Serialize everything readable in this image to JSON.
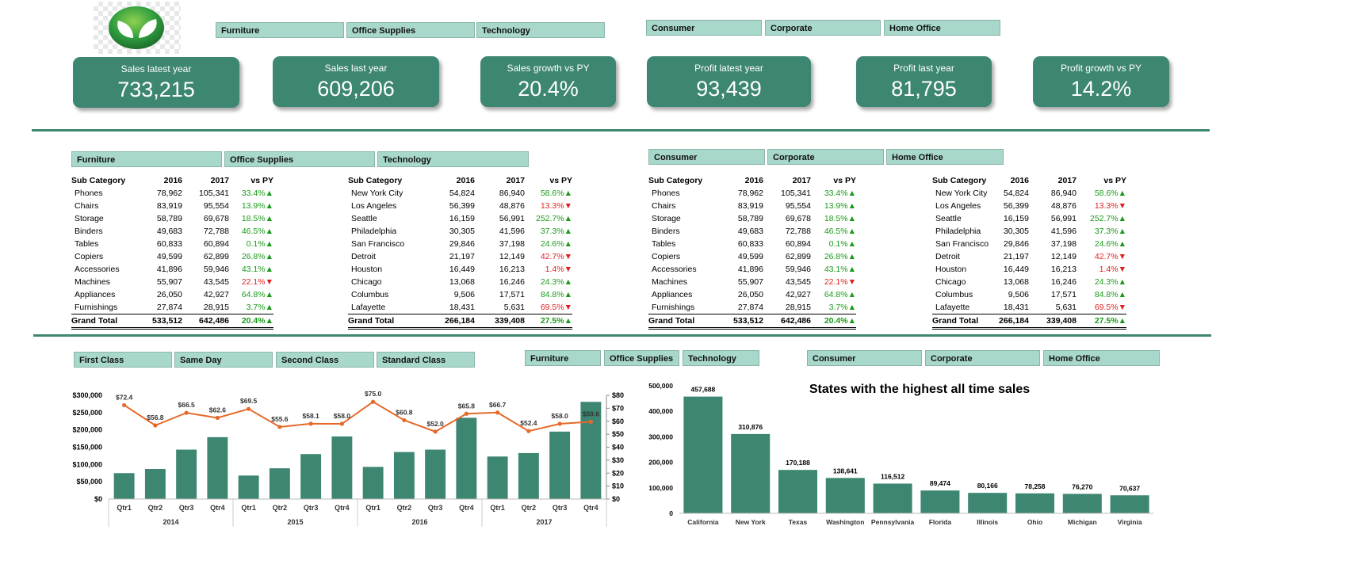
{
  "colors": {
    "accent": "#3d8672",
    "slicer": "#a8d8cb",
    "positive": "#1a9a1a",
    "negative": "#e02020",
    "line": "#e56a2a"
  },
  "logo_icon": "leaf-logo-icon",
  "slicers": {
    "category": [
      "Furniture",
      "Office Supplies",
      "Technology"
    ],
    "segment": [
      "Consumer",
      "Corporate",
      "Home Office"
    ],
    "ship_mode": [
      "First Class",
      "Same Day",
      "Second Class",
      "Standard Class"
    ]
  },
  "kpis": [
    {
      "title": "Sales latest year",
      "value": "733,215"
    },
    {
      "title": "Sales last year",
      "value": "609,206"
    },
    {
      "title": "Sales growth vs PY",
      "value": "20.4%"
    },
    {
      "title": "Profit latest year",
      "value": "93,439"
    },
    {
      "title": "Profit last year",
      "value": "81,795"
    },
    {
      "title": "Profit growth vs PY",
      "value": "14.2%"
    }
  ],
  "sub_table": {
    "headers": [
      "Sub Category",
      "2016",
      "2017",
      "vs PY"
    ],
    "rows": [
      [
        "Phones",
        "78,962",
        "105,341",
        "33.4%▲",
        "up"
      ],
      [
        "Chairs",
        "83,919",
        "95,554",
        "13.9%▲",
        "up"
      ],
      [
        "Storage",
        "58,789",
        "69,678",
        "18.5%▲",
        "up"
      ],
      [
        "Binders",
        "49,683",
        "72,788",
        "46.5%▲",
        "up"
      ],
      [
        "Tables",
        "60,833",
        "60,894",
        "0.1%▲",
        "up"
      ],
      [
        "Copiers",
        "49,599",
        "62,899",
        "26.8%▲",
        "up"
      ],
      [
        "Accessories",
        "41,896",
        "59,946",
        "43.1%▲",
        "up"
      ],
      [
        "Machines",
        "55,907",
        "43,545",
        "22.1%▼",
        "down"
      ],
      [
        "Appliances",
        "26,050",
        "42,927",
        "64.8%▲",
        "up"
      ],
      [
        "Furnishings",
        "27,874",
        "28,915",
        "3.7%▲",
        "up"
      ]
    ],
    "total": [
      "Grand Total",
      "533,512",
      "642,486",
      "20.4%▲"
    ]
  },
  "city_table": {
    "headers": [
      "Sub Category",
      "2016",
      "2017",
      "vs PY"
    ],
    "rows": [
      [
        "New York City",
        "54,824",
        "86,940",
        "58.6%▲",
        "up"
      ],
      [
        "Los Angeles",
        "56,399",
        "48,876",
        "13.3%▼",
        "down"
      ],
      [
        "Seattle",
        "16,159",
        "56,991",
        "252.7%▲",
        "up"
      ],
      [
        "Philadelphia",
        "30,305",
        "41,596",
        "37.3%▲",
        "up"
      ],
      [
        "San Francisco",
        "29,846",
        "37,198",
        "24.6%▲",
        "up"
      ],
      [
        "Detroit",
        "21,197",
        "12,149",
        "42.7%▼",
        "down"
      ],
      [
        "Houston",
        "16,449",
        "16,213",
        "1.4%▼",
        "down"
      ],
      [
        "Chicago",
        "13,068",
        "16,246",
        "24.3%▲",
        "up"
      ],
      [
        "Columbus",
        "9,506",
        "17,571",
        "84.8%▲",
        "up"
      ],
      [
        "Lafayette",
        "18,431",
        "5,631",
        "69.5%▼",
        "down"
      ]
    ],
    "total": [
      "Grand Total",
      "266,184",
      "339,408",
      "27.5%▲"
    ]
  },
  "chart_data": [
    {
      "type": "bar",
      "combo": "bar+line",
      "years": [
        "2014",
        "2015",
        "2016",
        "2017"
      ],
      "categories": [
        "Qtr1",
        "Qtr2",
        "Qtr3",
        "Qtr4",
        "Qtr1",
        "Qtr2",
        "Qtr3",
        "Qtr4",
        "Qtr1",
        "Qtr2",
        "Qtr3",
        "Qtr4",
        "Qtr1",
        "Qtr2",
        "Qtr3",
        "Qtr4"
      ],
      "series": [
        {
          "values": [
            75000,
            87000,
            143000,
            179000,
            68000,
            89000,
            130000,
            181000,
            93000,
            136000,
            143000,
            235000,
            123000,
            133000,
            195000,
            281000
          ]
        },
        {
          "axis": "secondary",
          "values": [
            72.4,
            56.8,
            66.5,
            62.6,
            69.5,
            55.6,
            58.1,
            58.0,
            75.0,
            60.8,
            52.0,
            65.8,
            66.7,
            52.4,
            58.0,
            59.6
          ]
        }
      ],
      "line_labels": [
        "$72.4",
        "$56.8",
        "$66.5",
        "$62.6",
        "$69.5",
        "$55.6",
        "$58.1",
        "$58.0",
        "$75.0",
        "$60.8",
        "$52.0",
        "$65.8",
        "$66.7",
        "$52.4",
        "$58.0",
        "$59.6"
      ],
      "y_ticks": [
        "$0",
        "$50,000",
        "$100,000",
        "$150,000",
        "$200,000",
        "$250,000",
        "$300,000"
      ],
      "y2_ticks": [
        "$0",
        "$10",
        "$20",
        "$30",
        "$40",
        "$50",
        "$60",
        "$70",
        "$80"
      ],
      "ylim": [
        0,
        300000
      ],
      "y2lim": [
        0,
        80
      ],
      "grid": false
    },
    {
      "type": "bar",
      "title": "States with the highest all time sales",
      "categories": [
        "California",
        "New York",
        "Texas",
        "Washington",
        "Pennsylvania",
        "Florida",
        "Illinois",
        "Ohio",
        "Michigan",
        "Virginia"
      ],
      "values": [
        457688,
        310876,
        170188,
        138641,
        116512,
        89474,
        80166,
        78258,
        76270,
        70637
      ],
      "value_labels": [
        "457,688",
        "310,876",
        "170,188",
        "138,641",
        "116,512",
        "89,474",
        "80,166",
        "78,258",
        "76,270",
        "70,637"
      ],
      "y_ticks": [
        "0",
        "100,000",
        "200,000",
        "300,000",
        "400,000",
        "500,000"
      ],
      "ylim": [
        0,
        500000
      ],
      "grid": false
    }
  ]
}
